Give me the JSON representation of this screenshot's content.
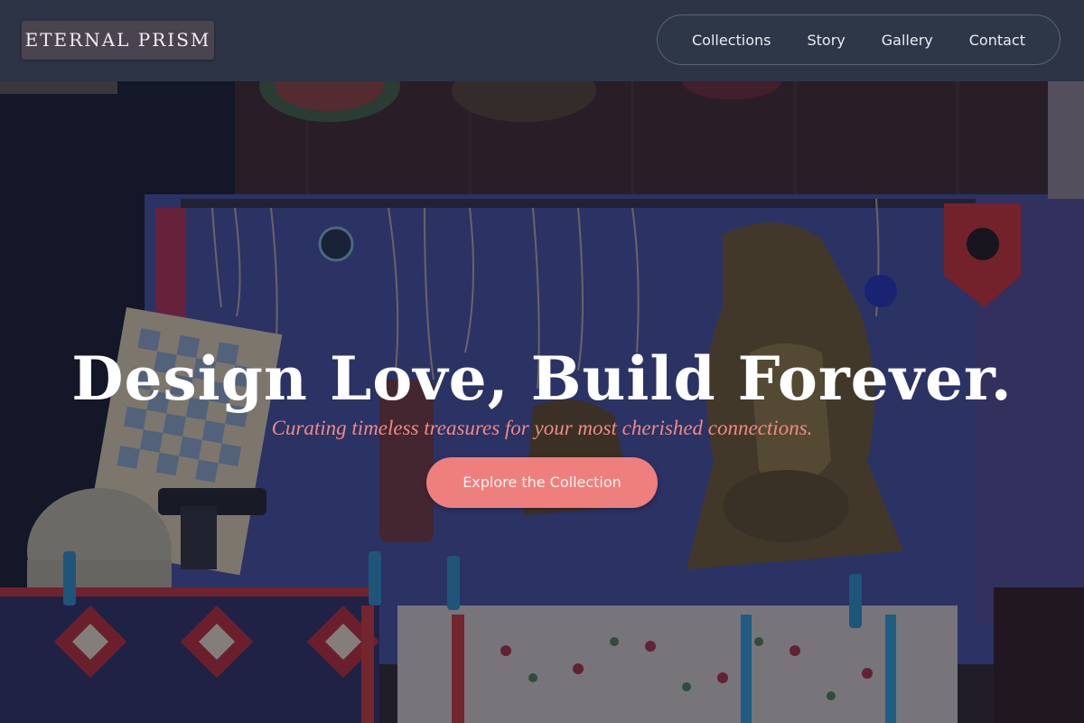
{
  "brand": {
    "logo_text": "ETERNAL PRISM"
  },
  "nav": {
    "items": [
      {
        "label": "Collections"
      },
      {
        "label": "Story"
      },
      {
        "label": "Gallery"
      },
      {
        "label": "Contact"
      }
    ]
  },
  "hero": {
    "title": "Design Love, Build Forever.",
    "subtitle": "Curating timeless treasures for your most cherished connections.",
    "cta_label": "Explore the Collection"
  },
  "colors": {
    "header_bg": "#2c3446",
    "logo_bg": "#4a4350",
    "accent_coral": "#ef7f7d",
    "subtitle_coral": "#f08a86",
    "title_white": "#ffffff"
  }
}
